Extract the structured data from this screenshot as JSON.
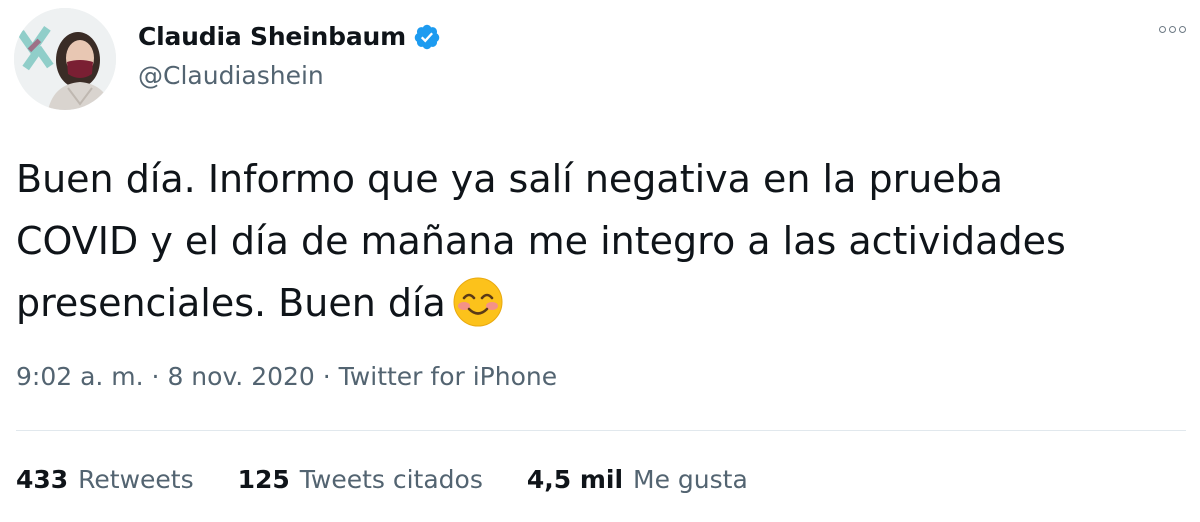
{
  "author": {
    "name": "Claudia Sheinbaum",
    "handle": "@Claudiashein"
  },
  "tweet": {
    "lines": [
      "Buen día. Informo que ya salí negativa en la prueba",
      "COVID y el día de mañana me integro a las actividades",
      "presenciales. Buen día"
    ]
  },
  "meta": {
    "time": "9:02 a. m.",
    "sep1": " · ",
    "date": "8 nov. 2020",
    "sep2": " · ",
    "source": "Twitter for iPhone"
  },
  "stats": [
    {
      "count": "433",
      "label": "Retweets"
    },
    {
      "count": "125",
      "label": "Tweets citados"
    },
    {
      "count": "4,5 mil",
      "label": "Me gusta"
    }
  ],
  "colors": {
    "verified": "#1d9bf0",
    "text": "#0f1419",
    "muted": "#536471",
    "divider": "#e1e8ed"
  },
  "icons": {
    "verified": "verified-badge-icon",
    "emoji": "smiling-face-with-smiling-eyes-icon",
    "more": "more-options-icon"
  }
}
